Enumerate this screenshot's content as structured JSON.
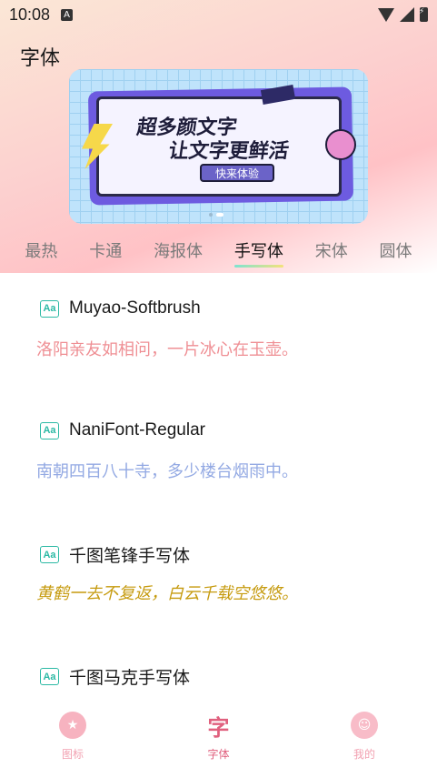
{
  "status_bar": {
    "time": "10:08",
    "indicator": "A"
  },
  "app_title": "字体",
  "banner": {
    "line1": "超多颜文字",
    "line2": "让文字更鲜活",
    "button_label": "快来体验"
  },
  "tabs": [
    {
      "label": "最热"
    },
    {
      "label": "卡通"
    },
    {
      "label": "海报体"
    },
    {
      "label": "手写体",
      "active": true
    },
    {
      "label": "宋体"
    },
    {
      "label": "圆体"
    }
  ],
  "fonts": [
    {
      "name": "Muyao-Softbrush",
      "sample": "洛阳亲友如相问，一片冰心在玉壶。",
      "sample_color": "#ef8f94"
    },
    {
      "name": "NaniFont-Regular",
      "sample": "南朝四百八十寺，多少楼台烟雨中。",
      "sample_color": "#93a9e3"
    },
    {
      "name": "千图笔锋手写体",
      "sample": "黄鹤一去不复返，白云千载空悠悠。",
      "sample_color": "#c69b0f"
    },
    {
      "name": "千图马克手写体",
      "sample": ""
    }
  ],
  "bottom_nav": [
    {
      "label": "图标",
      "icon": "emoji-icon"
    },
    {
      "label": "字体",
      "icon": "font-icon",
      "active": true
    },
    {
      "label": "我的",
      "icon": "smile-icon"
    }
  ],
  "colors": {
    "accent": "#e0607e",
    "aa_icon": "#2bb9a4"
  }
}
